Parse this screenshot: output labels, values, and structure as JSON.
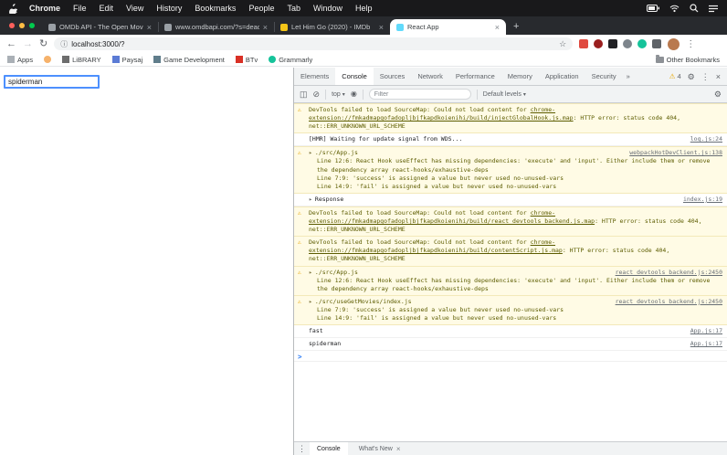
{
  "icons": {
    "close": "×",
    "new_tab": "+",
    "back": "←",
    "forward": "→",
    "reload": "↻",
    "info": "ⓘ",
    "star": "☆",
    "more_vertical": "⋮",
    "overflow": "»",
    "dropdown": "▾",
    "warning": "⚠",
    "gear": "⚙",
    "clear": "⊘",
    "panel": "◫",
    "eye": "◉",
    "expand": "▸",
    "prompt": ">"
  },
  "menubar": {
    "items": [
      "Chrome",
      "File",
      "Edit",
      "View",
      "History",
      "Bookmarks",
      "People",
      "Tab",
      "Window",
      "Help"
    ]
  },
  "browser": {
    "tabs": [
      {
        "title": "OMDb API - The Open Movie D",
        "favicon_color": "#9aa0a6",
        "active": false
      },
      {
        "title": "www.omdbapi.com/?s=deadpo",
        "favicon_color": "#9aa0a6",
        "active": false
      },
      {
        "title": "Let Him Go (2020) - IMDb",
        "favicon_color": "#f5c518",
        "active": false
      },
      {
        "title": "React App",
        "favicon_color": "#61dafb",
        "active": true
      }
    ],
    "url": "localhost:3000/?",
    "extensions": [
      {
        "color": "#e04a3f",
        "round": false
      },
      {
        "color": "#9a1f1f",
        "round": true
      },
      {
        "color": "#202124",
        "round": false
      },
      {
        "color": "#7d858c",
        "round": true
      },
      {
        "color": "#15c39a",
        "round": true
      },
      {
        "color": "#5f6368",
        "round": false
      }
    ]
  },
  "bookmarks": {
    "items": [
      {
        "label": "Apps",
        "color": "#aab0b6",
        "round": false
      },
      {
        "label": "",
        "color": "#f6b26b",
        "round": true
      },
      {
        "label": "LiBRARY",
        "color": "#6d6d6d",
        "round": false
      },
      {
        "label": "Paysaj",
        "color": "#5b7bd5",
        "round": false
      },
      {
        "label": "Game Development",
        "color": "#607d8b",
        "round": false
      },
      {
        "label": "BTv",
        "color": "#d93025",
        "round": false
      },
      {
        "label": "Grammarly",
        "color": "#15c39a",
        "round": true
      }
    ],
    "other_label": "Other Bookmarks"
  },
  "page": {
    "input_value": "spiderman"
  },
  "devtools": {
    "tabs": [
      "Elements",
      "Console",
      "Sources",
      "Network",
      "Performance",
      "Memory",
      "Application",
      "Security"
    ],
    "active_tab": "Console",
    "warning_count": "4",
    "console": {
      "context": "top",
      "filter_placeholder": "Filter",
      "levels": "Default levels",
      "messages": [
        {
          "type": "warn",
          "rows": [
            {
              "segments": [
                {
                  "t": "DevTools failed to load SourceMap: Could not load content for "
                },
                {
                  "t": "chrome-extension://fmkadmapgofadopljbjfkapdkoienihi/build/injectGlobalHook.js.map",
                  "link": true
                },
                {
                  "t": ": HTTP error: status code 404, net::ERR_UNKNOWN_URL_SCHEME"
                }
              ]
            }
          ]
        },
        {
          "type": "log",
          "source": "log.js:24",
          "rows": [
            {
              "segments": [
                {
                  "t": "[HMR] Waiting for update signal from WDS..."
                }
              ]
            }
          ]
        },
        {
          "type": "warn",
          "source": "webpackHotDevClient.js:138",
          "rows": [
            {
              "arrow": true,
              "segments": [
                {
                  "t": "./src/App.js"
                }
              ]
            },
            {
              "indent": true,
              "segments": [
                {
                  "t": "Line 12:6:  React Hook useEffect has missing dependencies: 'execute' and 'input'. Either include them or remove the dependency array  react-hooks/exhaustive-deps"
                }
              ]
            },
            {
              "indent": true,
              "segments": [
                {
                  "t": "Line 7:9:   'success' is assigned a value but never used  no-unused-vars"
                }
              ]
            },
            {
              "indent": true,
              "segments": [
                {
                  "t": "Line 14:9:  'fail' is assigned a value but never used     no-unused-vars"
                }
              ]
            }
          ]
        },
        {
          "type": "log",
          "source": "index.js:19",
          "rows": [
            {
              "arrow": true,
              "segments": [
                {
                  "t": "Response"
                }
              ]
            }
          ]
        },
        {
          "type": "warn",
          "rows": [
            {
              "segments": [
                {
                  "t": "DevTools failed to load SourceMap: Could not load content for "
                },
                {
                  "t": "chrome-extension://fmkadmapgofadopljbjfkapdkoienihi/build/react_devtools_backend.js.map",
                  "link": true
                },
                {
                  "t": ": HTTP error: status code 404, net::ERR_UNKNOWN_URL_SCHEME"
                }
              ]
            }
          ]
        },
        {
          "type": "warn",
          "rows": [
            {
              "segments": [
                {
                  "t": "DevTools failed to load SourceMap: Could not load content for "
                },
                {
                  "t": "chrome-extension://fmkadmapgofadopljbjfkapdkoienihi/build/contentScript.js.map",
                  "link": true
                },
                {
                  "t": ": HTTP error: status code 404, net::ERR_UNKNOWN_URL_SCHEME"
                }
              ]
            }
          ]
        },
        {
          "type": "warn",
          "source": "react_devtools_backend.js:2450",
          "rows": [
            {
              "arrow": true,
              "segments": [
                {
                  "t": "./src/App.js"
                }
              ]
            },
            {
              "indent": true,
              "segments": [
                {
                  "t": "Line 12:6:  React Hook useEffect has missing dependencies: 'execute' and 'input'. Either include them or remove the dependency array  react-hooks/exhaustive-deps"
                }
              ]
            }
          ]
        },
        {
          "type": "warn",
          "source": "react_devtools_backend.js:2450",
          "rows": [
            {
              "arrow": true,
              "segments": [
                {
                  "t": "./src/useGetMovies/index.js"
                }
              ]
            },
            {
              "indent": true,
              "segments": [
                {
                  "t": "Line 7:9:  'success' is assigned a value but never used  no-unused-vars"
                }
              ]
            },
            {
              "indent": true,
              "segments": [
                {
                  "t": "Line 14:9:  'fail' is assigned a value but never used  no-unused-vars"
                }
              ]
            }
          ]
        },
        {
          "type": "log",
          "source": "App.js:17",
          "rows": [
            {
              "segments": [
                {
                  "t": "fast"
                }
              ]
            }
          ]
        },
        {
          "type": "log",
          "source": "App.js:17",
          "rows": [
            {
              "segments": [
                {
                  "t": "spiderman"
                }
              ]
            }
          ]
        },
        {
          "type": "prompt",
          "rows": []
        }
      ]
    },
    "drawer": {
      "console_label": "Console",
      "whats_new_label": "What's New"
    }
  }
}
